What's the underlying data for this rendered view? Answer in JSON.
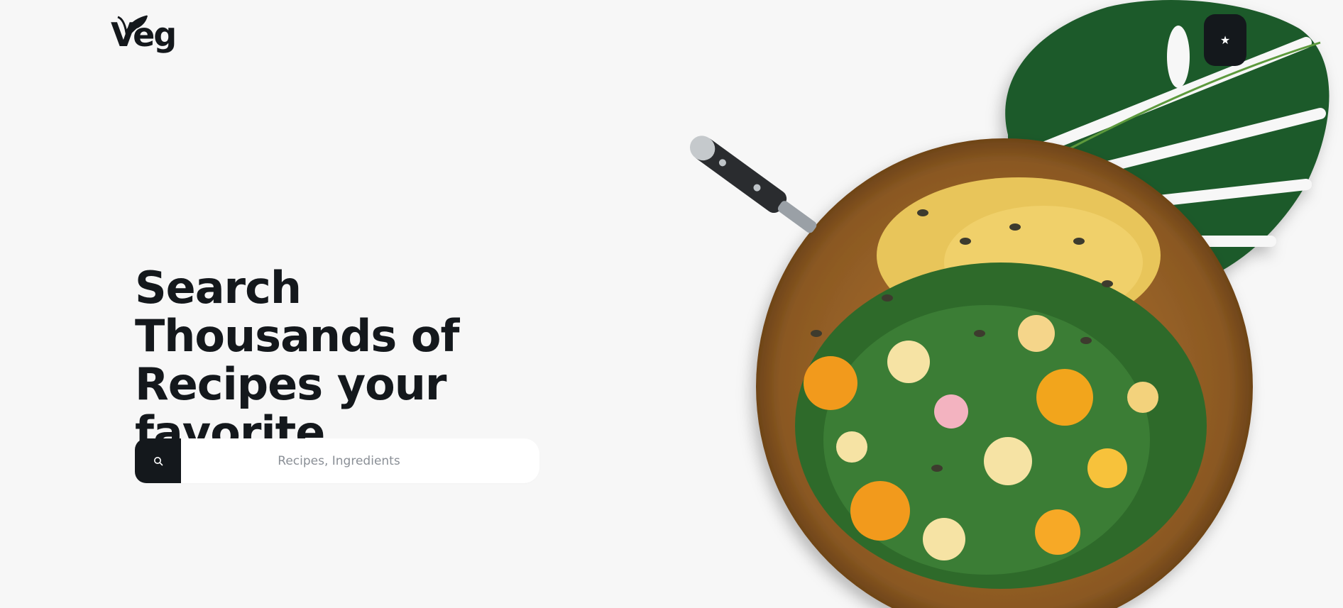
{
  "brand": {
    "logo_text": "Veg"
  },
  "hero": {
    "title": "Search Thousands of Recipes your favorite"
  },
  "search": {
    "placeholder": "Recipes, Ingredients",
    "button_icon": "search-icon"
  },
  "favorites": {
    "icon": "star-icon"
  },
  "colors": {
    "background": "#f7f7f7",
    "dark": "#14181c",
    "input_bg": "#ffffff",
    "placeholder": "#8a8f96",
    "leaf_green": "#1f5a2b"
  }
}
